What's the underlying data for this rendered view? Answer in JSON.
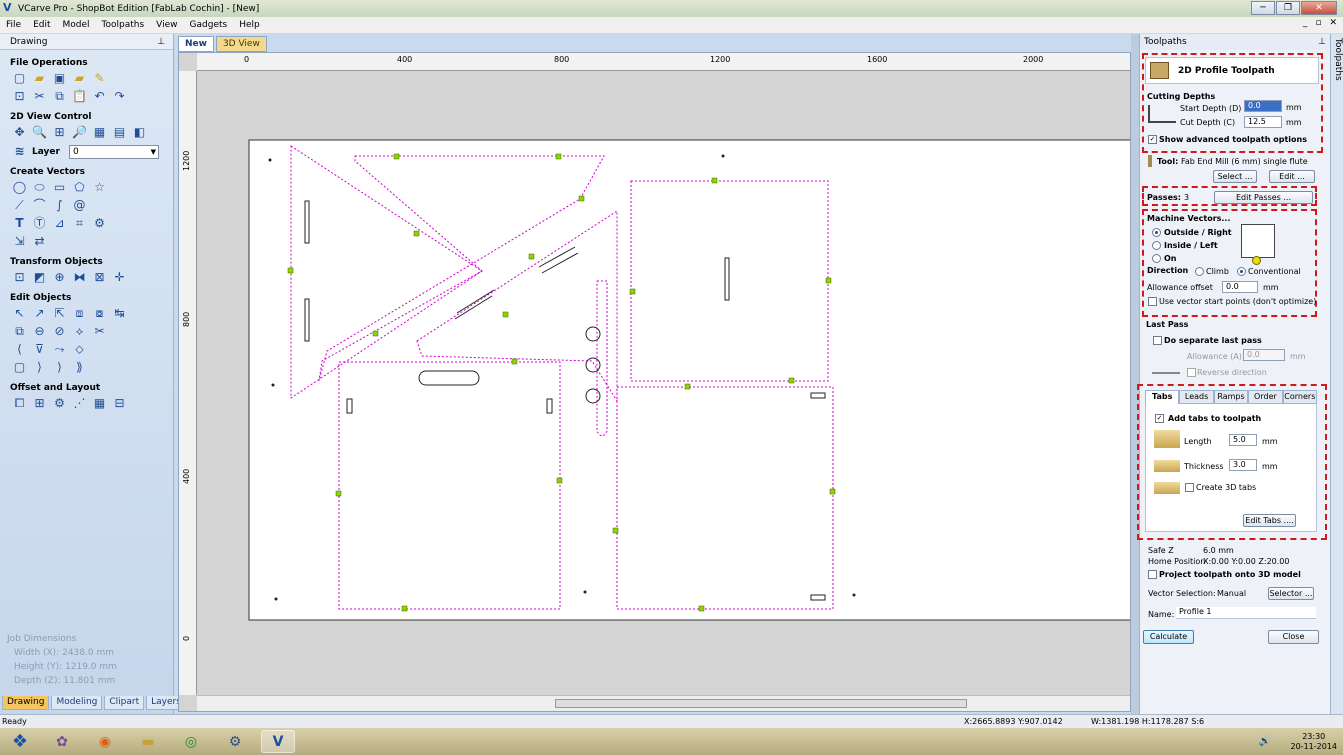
{
  "window": {
    "title": "VCarve Pro - ShopBot Edition [FabLab Cochin] - [New]",
    "controls": [
      "─",
      "❐",
      "✕"
    ],
    "mdi_controls": [
      "_",
      "▫",
      "✕"
    ]
  },
  "menu": [
    "File",
    "Edit",
    "Model",
    "Toolpaths",
    "View",
    "Gadgets",
    "Help"
  ],
  "left_panel": {
    "header": "Drawing",
    "sections": [
      {
        "title": "File Operations"
      },
      {
        "title": "2D View Control"
      },
      {
        "title": "Create Vectors"
      },
      {
        "title": "Transform Objects"
      },
      {
        "title": "Edit Objects"
      },
      {
        "title": "Offset and Layout"
      }
    ],
    "layer_label": "Layer",
    "layer_value": "0",
    "job_dimensions": {
      "title": "Job Dimensions",
      "width": "Width  (X): 2438.0 mm",
      "height": "Height (Y): 1219.0 mm",
      "depth": "Depth  (Z): 11.801 mm"
    },
    "tabs": [
      "Drawing",
      "Modeling",
      "Clipart",
      "Layers"
    ]
  },
  "view_tabs": [
    "New",
    "3D View"
  ],
  "rulers": {
    "h_labels": [
      "0",
      "400",
      "800",
      "1200",
      "1600",
      "2000"
    ],
    "v_labels": [
      "1200",
      "800",
      "400",
      "0"
    ]
  },
  "toolpaths_panel": {
    "header": "Toolpaths",
    "side_tab": "Toolpaths",
    "title": "2D Profile Toolpath",
    "cutting_depths": "Cutting Depths",
    "start_depth_label": "Start Depth (D)",
    "start_depth_value": "0.0",
    "cut_depth_label": "Cut Depth (C)",
    "cut_depth_value": "12.5",
    "unit": "mm",
    "show_advanced": "Show advanced toolpath options",
    "tool_label": "Tool:",
    "tool_value": "Fab End Mill (6 mm) single flute",
    "select_btn": "Select ...",
    "edit_btn": "Edit ...",
    "passes_label": "Passes:",
    "passes_value": "3",
    "edit_passes_btn": "Edit Passes ...",
    "machine_vectors": "Machine Vectors...",
    "outside_right": "Outside / Right",
    "inside_left": "Inside / Left",
    "on": "On",
    "direction_label": "Direction",
    "climb": "Climb",
    "conventional": "Conventional",
    "allowance_label": "Allowance offset",
    "allowance_value": "0.0",
    "vector_start": "Use vector start points (don't optimize)",
    "last_pass": "Last Pass",
    "separate_last_pass": "Do separate last pass",
    "allowance_a_label": "Allowance (A)",
    "allowance_a_value": "0.0",
    "reverse_direction": "Reverse direction",
    "tabs": [
      "Tabs",
      "Leads",
      "Ramps",
      "Order",
      "Corners"
    ],
    "add_tabs": "Add tabs to toolpath",
    "length_label": "Length",
    "length_value": "5.0",
    "thickness_label": "Thickness",
    "thickness_value": "3.0",
    "create_3d_tabs": "Create 3D tabs",
    "edit_tabs_btn": "Edit Tabs ....",
    "safe_z_label": "Safe Z",
    "safe_z_value": "6.0 mm",
    "home_label": "Home Position",
    "home_value": "X:0.00 Y:0.00 Z:20.00",
    "project_3d": "Project toolpath onto 3D model",
    "vector_selection_label": "Vector Selection:",
    "vector_selection_value": "Manual",
    "selector_btn": "Selector ...",
    "name_label": "Name:",
    "name_value": "Profile 1",
    "calculate_btn": "Calculate",
    "close_btn": "Close"
  },
  "status": {
    "ready": "Ready",
    "coords": "X:2665.8893 Y:907.0142",
    "size": "W:1381.198  H:1178.287  S:6"
  },
  "taskbar": {
    "time": "23:30",
    "date": "20-11-2014"
  },
  "colors": {
    "dashed_highlight": "#d01919",
    "vector_magenta": "#d000d0",
    "tab_marker": "#8fd400"
  }
}
